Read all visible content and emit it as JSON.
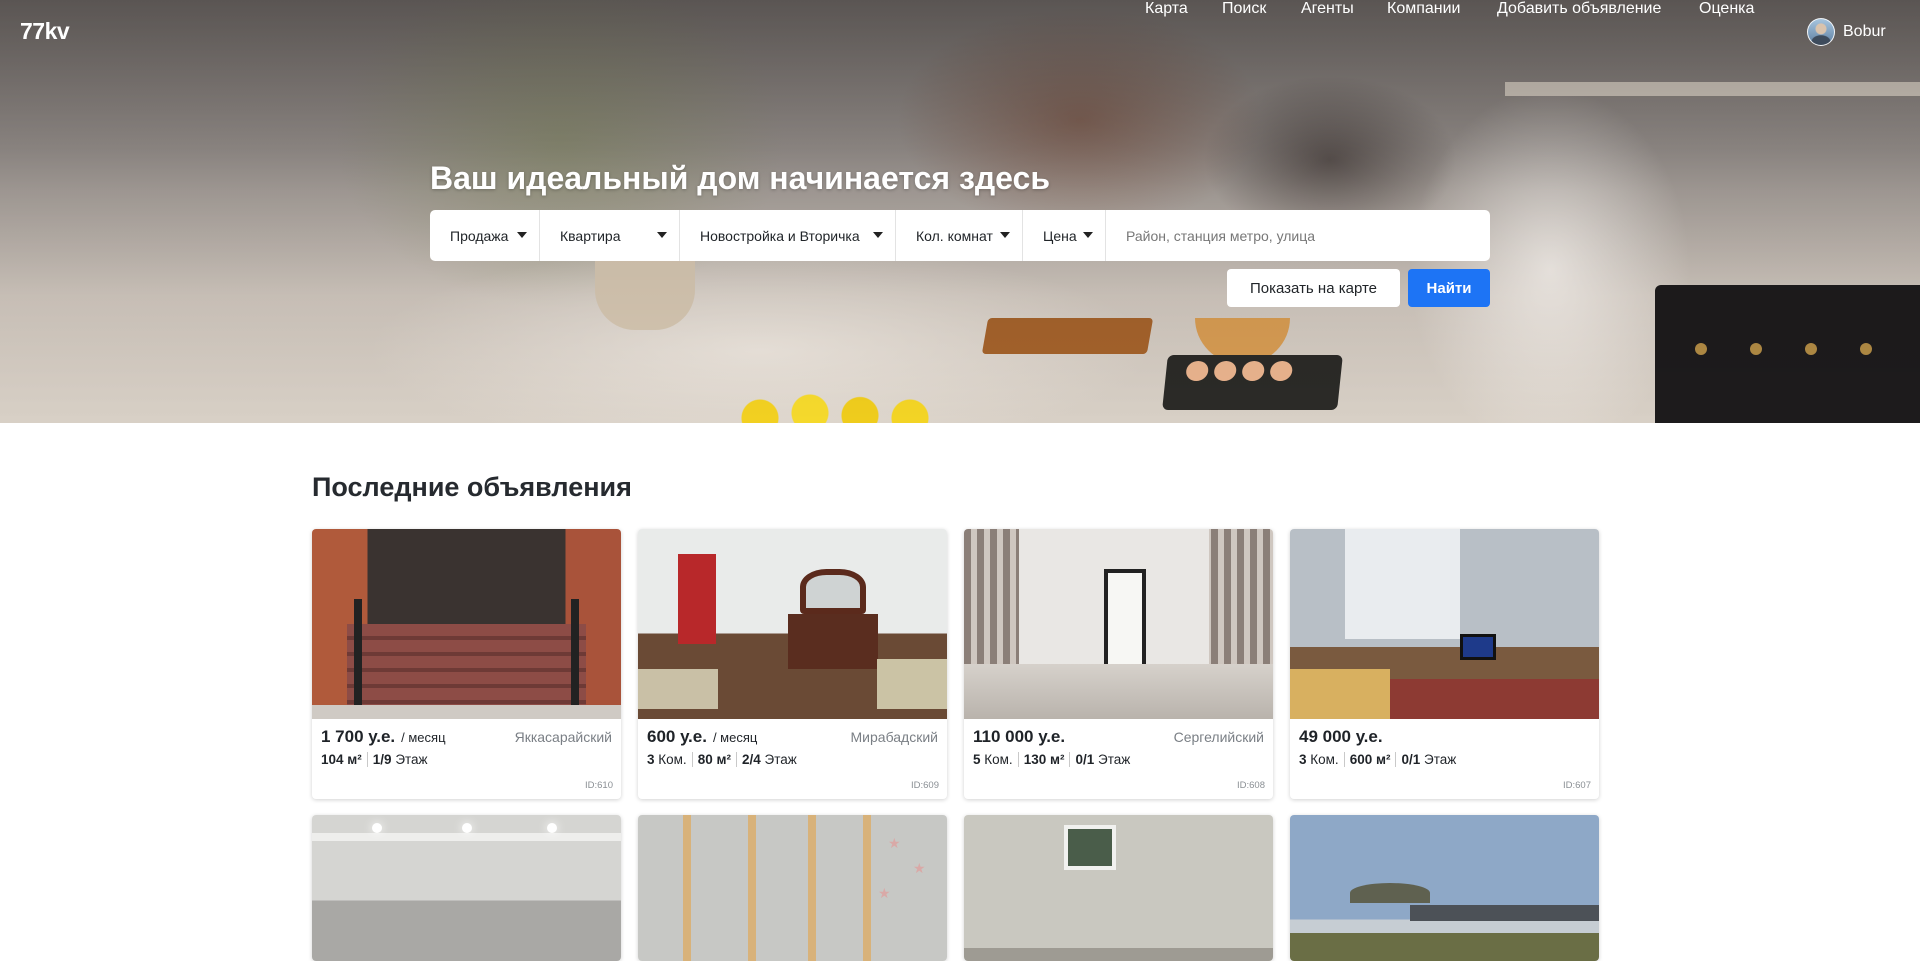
{
  "brand": {
    "logo": "77kv"
  },
  "nav": {
    "links": [
      "Карта",
      "Поиск",
      "Агенты",
      "Компании",
      "Добавить объявление",
      "Оценка"
    ],
    "user_name": "Bobur"
  },
  "hero": {
    "headline": "Ваш идеальный дом начинается здесь",
    "filters": {
      "deal_type": "Продажа",
      "property_type": "Квартира",
      "market": "Новостройка и Вторичка",
      "rooms": "Кол. комнат",
      "price": "Цена"
    },
    "search_placeholder": "Район, станция метро, улица",
    "show_on_map_label": "Показать на карте",
    "find_label": "Найти"
  },
  "listings": {
    "title": "Последние объявления",
    "cards": [
      {
        "price": "1 700 у.е.",
        "period": "/ месяц",
        "district": "Яккасарайский",
        "specs": [
          {
            "value": "104 м²",
            "unit": ""
          },
          {
            "value": "1/9",
            "unit": "Этаж"
          }
        ],
        "id": "ID:610"
      },
      {
        "price": "600 у.е.",
        "period": "/ месяц",
        "district": "Мирабадский",
        "specs": [
          {
            "value": "3",
            "unit": "Ком."
          },
          {
            "value": "80 м²",
            "unit": ""
          },
          {
            "value": "2/4",
            "unit": "Этаж"
          }
        ],
        "id": "ID:609"
      },
      {
        "price": "110 000 у.е.",
        "period": "",
        "district": "Сергелийский",
        "specs": [
          {
            "value": "5",
            "unit": "Ком."
          },
          {
            "value": "130 м²",
            "unit": ""
          },
          {
            "value": "0/1",
            "unit": "Этаж"
          }
        ],
        "id": "ID:608"
      },
      {
        "price": "49 000 у.е.",
        "period": "",
        "district": "",
        "specs": [
          {
            "value": "3",
            "unit": "Ком."
          },
          {
            "value": "600 м²",
            "unit": ""
          },
          {
            "value": "0/1",
            "unit": "Этаж"
          }
        ],
        "id": "ID:607"
      }
    ]
  },
  "icons": {
    "caret": "caret-down-icon",
    "avatar": "user-avatar"
  },
  "colors": {
    "primary": "#1d74f5",
    "text": "#1f2328",
    "muted": "#7a7f85"
  }
}
